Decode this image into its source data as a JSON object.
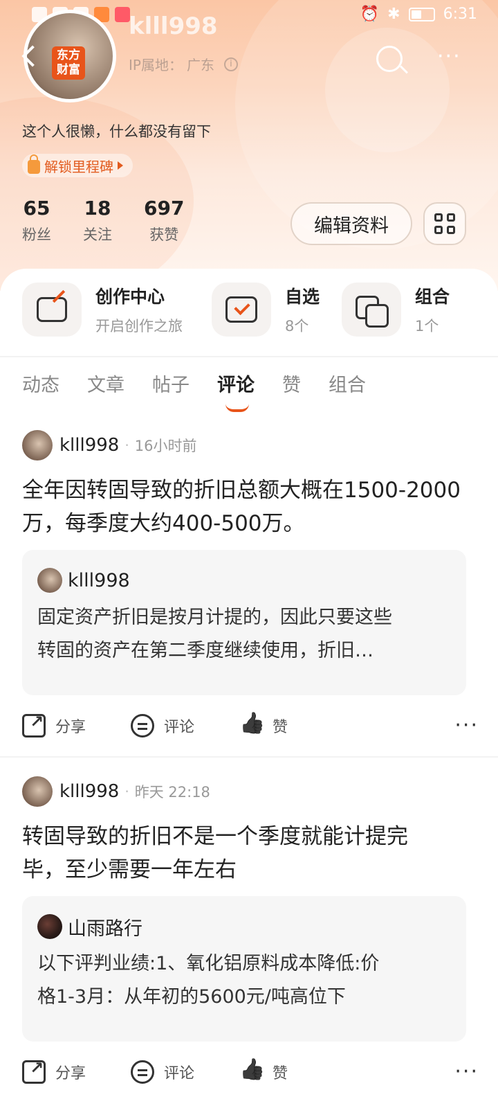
{
  "status_bar": {
    "time": "6:31"
  },
  "profile": {
    "logo_text": "东方\n财富",
    "username": "klll998",
    "ip_label": "IP属地：",
    "ip_location": "广东",
    "bio": "这个人很懒，什么都没有留下",
    "milestone": "解锁里程碑",
    "stats": [
      {
        "value": "65",
        "label": "粉丝"
      },
      {
        "value": "18",
        "label": "关注"
      },
      {
        "value": "697",
        "label": "获赞"
      }
    ],
    "edit_button": "编辑资料"
  },
  "shortcuts": [
    {
      "title": "创作中心",
      "sub": "开启创作之旅"
    },
    {
      "title": "自选",
      "sub": "8个"
    },
    {
      "title": "组合",
      "sub": "1个"
    }
  ],
  "tabs": [
    "动态",
    "文章",
    "帖子",
    "评论",
    "赞",
    "组合"
  ],
  "active_tab": "评论",
  "accent_color": "#e8541a",
  "posts": [
    {
      "author": "klll998",
      "time": "16小时前",
      "text": "全年因转固导致的折旧总额大概在1500-2000万，每季度大约400-500万。",
      "quote_author": "klll998",
      "quote_line1": "固定资产折旧是按月计提的，因此只要这些",
      "quote_line2": "转固的资产在第二季度继续使用，折旧…"
    },
    {
      "author": "klll998",
      "time": "昨天 22:18",
      "text": "转固导致的折旧不是一个季度就能计提完毕，至少需要一年左右",
      "quote_author": "山雨路行",
      "quote_line1": "以下评判业绩:1、氧化铝原料成本降低:价",
      "quote_line2": "格1-3月：从年初的5600元/吨高位下"
    }
  ],
  "actions": {
    "share": "分享",
    "comment": "评论",
    "like": "赞"
  }
}
